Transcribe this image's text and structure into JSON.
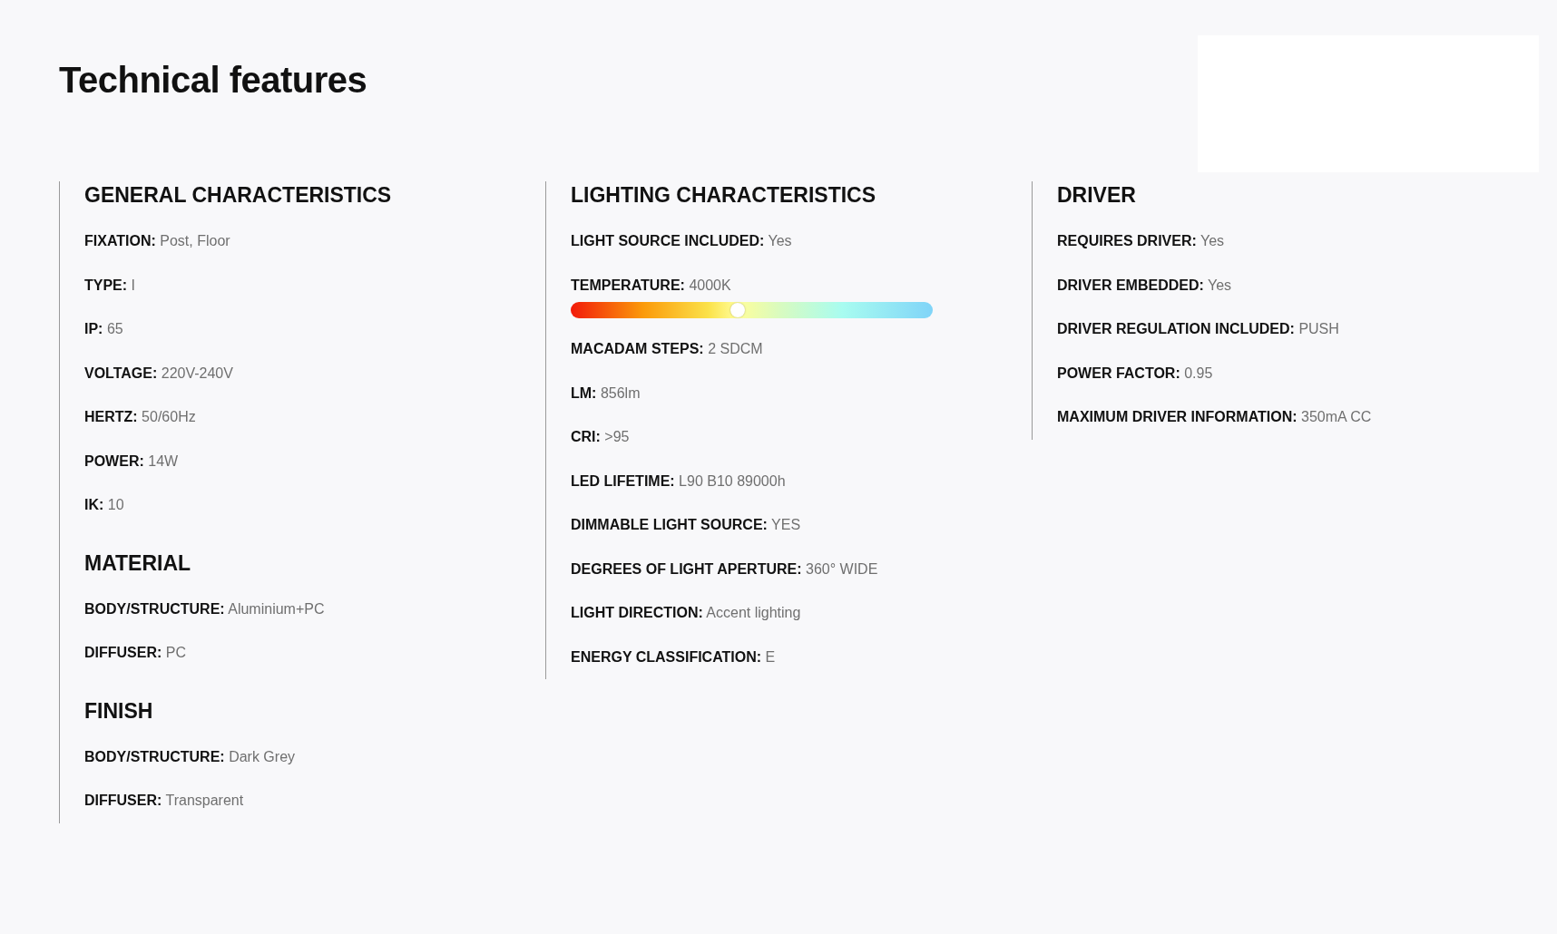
{
  "title": "Technical features",
  "columns": [
    {
      "sections": [
        {
          "heading": "GENERAL CHARACTERISTICS",
          "rows": [
            {
              "kind": "text",
              "label": "FIXATION:",
              "value": "Post, Floor"
            },
            {
              "kind": "text",
              "label": "TYPE:",
              "value": "I"
            },
            {
              "kind": "text",
              "label": "IP:",
              "value": "65"
            },
            {
              "kind": "text",
              "label": "VOLTAGE:",
              "value": "220V-240V"
            },
            {
              "kind": "text",
              "label": "HERTZ:",
              "value": "50/60Hz"
            },
            {
              "kind": "text",
              "label": "POWER:",
              "value": "14W"
            },
            {
              "kind": "text",
              "label": "IK:",
              "value": "10"
            }
          ]
        },
        {
          "heading": "MATERIAL",
          "rows": [
            {
              "kind": "text",
              "label": "BODY/STRUCTURE:",
              "value": "Aluminium+PC"
            },
            {
              "kind": "text",
              "label": "DIFFUSER:",
              "value": "PC"
            }
          ]
        },
        {
          "heading": "FINISH",
          "rows": [
            {
              "kind": "text",
              "label": "BODY/STRUCTURE:",
              "value": "Dark Grey"
            },
            {
              "kind": "text",
              "label": "DIFFUSER:",
              "value": "Transparent"
            }
          ]
        }
      ]
    },
    {
      "sections": [
        {
          "heading": "LIGHTING CHARACTERISTICS",
          "rows": [
            {
              "kind": "text",
              "label": "LIGHT SOURCE INCLUDED:",
              "value": "Yes"
            },
            {
              "kind": "scale",
              "label": "TEMPERATURE:",
              "value": "4000K",
              "level": 0.46
            },
            {
              "kind": "text",
              "label": "MACADAM STEPS:",
              "value": "2 SDCM"
            },
            {
              "kind": "text",
              "label": "LM:",
              "value": "856lm"
            },
            {
              "kind": "text",
              "label": "CRI:",
              "value": ">95"
            },
            {
              "kind": "text",
              "label": "LED LIFETIME:",
              "value": "L90 B10 89000h"
            },
            {
              "kind": "text",
              "label": "DIMMABLE LIGHT SOURCE:",
              "value": "YES"
            },
            {
              "kind": "text",
              "label": "DEGREES OF LIGHT APERTURE:",
              "value": "360° WIDE"
            },
            {
              "kind": "text",
              "label": "LIGHT DIRECTION:",
              "value": "Accent lighting"
            },
            {
              "kind": "text",
              "label": "ENERGY CLASSIFICATION:",
              "value": "E"
            }
          ]
        }
      ]
    },
    {
      "sections": [
        {
          "heading": "DRIVER",
          "rows": [
            {
              "kind": "text",
              "label": "REQUIRES DRIVER:",
              "value": "Yes"
            },
            {
              "kind": "text",
              "label": "DRIVER EMBEDDED:",
              "value": "Yes"
            },
            {
              "kind": "text",
              "label": "DRIVER REGULATION INCLUDED:",
              "value": "PUSH"
            },
            {
              "kind": "text",
              "label": "POWER FACTOR:",
              "value": "0.95"
            },
            {
              "kind": "text",
              "label": "MAXIMUM DRIVER INFORMATION:",
              "value": "350mA CC"
            }
          ]
        }
      ]
    }
  ]
}
